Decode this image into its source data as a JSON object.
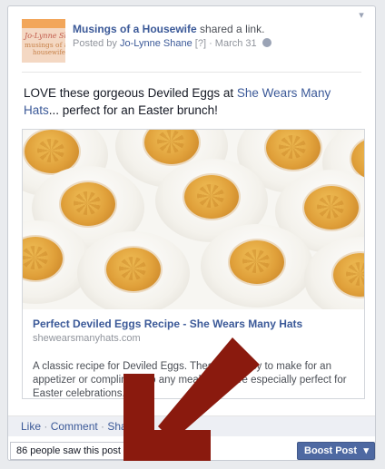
{
  "post": {
    "page_name": "Musings of a Housewife",
    "action": "shared a link.",
    "posted_by_prefix": "Posted by",
    "author": "Jo-Lynne Shane",
    "help_marker": "[?]",
    "date": "March 31",
    "avatar": {
      "line1": "Jo-Lynne Shane's",
      "line2": "musings of a",
      "line3": "housewife"
    },
    "message_before": "LOVE these gorgeous Deviled Eggs at ",
    "message_link": "She Wears Many Hats",
    "message_after": "... perfect for an Easter brunch!"
  },
  "attachment": {
    "title": "Perfect Deviled Eggs Recipe - She Wears Many Hats",
    "domain": "shewearsmanyhats.com",
    "description": "A classic recipe for Deviled Eggs. These are easy to make for an appetizer or compliment to any meal. They are especially perfect for Easter celebrations."
  },
  "actions": {
    "like": "Like",
    "comment": "Comment",
    "share": "Share",
    "separator": " · "
  },
  "insights": {
    "reach_text": "86 people saw this post"
  },
  "boost": {
    "label": "Boost Post"
  },
  "icons": [
    "chevron-down-icon",
    "globe-icon",
    "red-arrow-annotation"
  ],
  "colors": {
    "link": "#3b5998",
    "boost_bg": "#4e69a2",
    "arrow": "#8a1a0e"
  }
}
